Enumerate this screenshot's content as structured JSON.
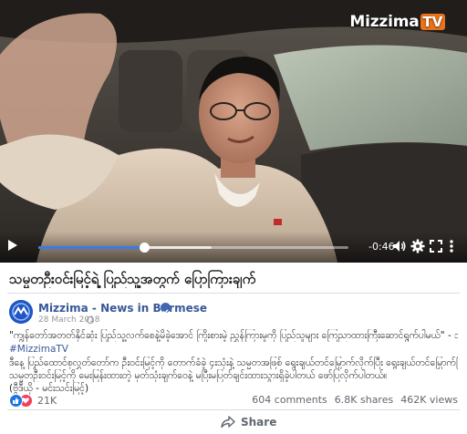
{
  "video": {
    "watermark_main": "Mizzima",
    "watermark_tv": "TV",
    "time_remaining": "-0:46",
    "progress_played": 0.34,
    "progress_buffered": 0.56
  },
  "post": {
    "title": "သမ္မတဦးဝင်းမြင့်ရဲ့ ပြည်သူ့အတွက် ပြောကြားချက်",
    "page_name": "Mizzima - News in Burmese",
    "date": "28 March 2018",
    "body_lines": [
      "\"ကျွန်တော်အတတ်နိုင်ဆုံး ပြည်သူ့လက်စေနဲ့မိခဲ့အောင် ကြိုးစားမဲ့ ညွှန်ကြားမှုကို ပြည်သူများ ကြေညာထားကြီးဆောင်ရွက်ပါမယ်\" - သမ္မတ ဦးဝင်းမြင့်",
      "#MizzimaTV",
      "ဒီနေ့ ပြည်ထောင်စုလွှတ်တော်က ဦးဝင်းမြင့်ကို တောက်ခံခဲ့ ၄းသုံးနဲ့ သမ္မတအဖြစ် ရွေးချယ်တင်မြှောက်လိုက်ပြီး ရွေးချယ်တင်မြှောက်ပြီးပြီးချင်းမှာ",
      "သမ္မတဦးဝင်းမြင့်ကို မေးမြန်းထားတဲ့ မှတ်သုံးချက်ဝေနဲ့ မပြီးမပြတ်ချင်းထားသွားရှိခဲ့ပါတယ် ဖော်ပြလိုက်ပါတယ်။",
      "(ဗွီဒီယို - မင်းသင်းမြင့်)"
    ],
    "reaction_count": "21K",
    "comments": "604 comments",
    "shares": "6.8K shares",
    "views": "462K views",
    "share_label": "Share"
  },
  "colors": {
    "accent": "#3b79e6",
    "link": "#385898",
    "like": "#1b74e4",
    "love": "#f33e58",
    "watermark_tv": "#e8731c"
  },
  "icons": {
    "play": "play-icon",
    "volume": "volume-icon",
    "settings": "gear-icon",
    "fullscreen": "fullscreen-icon",
    "more": "more-vertical-icon",
    "verified": "verified-badge-icon",
    "globe": "globe-icon",
    "share": "share-arrow-icon"
  }
}
